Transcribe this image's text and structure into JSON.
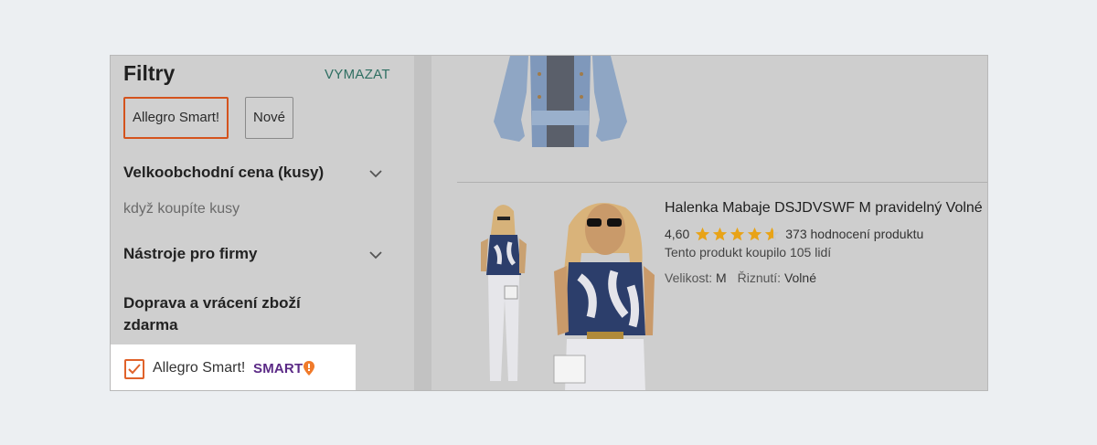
{
  "filters": {
    "title": "Filtry",
    "clear_label": "VYMAZAT",
    "chips": [
      "Allegro Smart!",
      "Nové"
    ],
    "sections": {
      "wholesale_price": "Velkoobchodní cena (kusy)",
      "wholesale_hint": "když koupíte kusy",
      "business_tools": "Nástroje pro firmy",
      "shipping_line1": "Doprava a vrácení zboží",
      "shipping_line2": "zdarma"
    },
    "smart_option": {
      "label": "Allegro Smart!",
      "logo_text": "SMART",
      "checked": true,
      "accent_color": "#e0622a",
      "logo_color": "#5b2a86"
    }
  },
  "product": {
    "title": "Halenka Mabaje DSJDVSWF M pravidelný Volné",
    "rating": "4,60",
    "rating_value": 4.6,
    "rating_max": 5,
    "reviews": "373 hodnocení produktu",
    "bought": "Tento produkt koupilo 105 lidí",
    "size_label": "Velikost:",
    "size_value": "M",
    "cut_label": "Řiznutí:",
    "cut_value": "Volné",
    "star_color": "#e8a317"
  }
}
